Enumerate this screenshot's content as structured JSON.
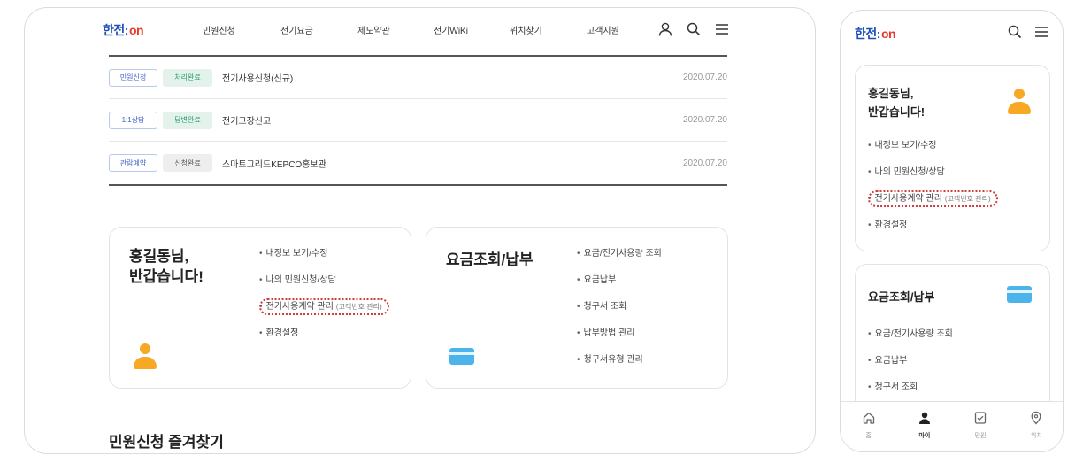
{
  "brand": {
    "logo_part1": "한전:",
    "logo_part2": "on",
    "primary": "#1d4fb8",
    "accent": "#e8392b"
  },
  "desktop": {
    "nav": [
      "민원신청",
      "전기요금",
      "제도약관",
      "전기WiKi",
      "위치찾기",
      "고객지원"
    ],
    "header_icons": [
      "user-icon",
      "search-icon",
      "menu-icon"
    ],
    "requests": [
      {
        "type": "민원신청",
        "status": "처리완료",
        "status_style": "green",
        "title": "전기사용신청(신규)",
        "date": "2020.07.20"
      },
      {
        "type": "1:1상담",
        "status": "답변완료",
        "status_style": "green",
        "title": "전기고장신고",
        "date": "2020.07.20"
      },
      {
        "type": "관람예약",
        "status": "신청완료",
        "status_style": "gray",
        "title": "스마트그리드KEPCO홍보관",
        "date": "2020.07.20"
      }
    ],
    "favorites_heading": "민원신청 즐겨찾기"
  },
  "account": {
    "greeting_line1": "홍길동님,",
    "greeting_line2": "반갑습니다!",
    "menu": [
      "내정보 보기/수정",
      "나의 민원신청/상담",
      "전기사용계약 관리",
      "환경설정"
    ],
    "menu_highlight_sub": "(고객번호 관리)"
  },
  "billing": {
    "title": "요금조회/납부",
    "menu": [
      "요금/전기사용량 조회",
      "요금납부",
      "청구서 조회",
      "납부방법 관리",
      "청구서유형 관리"
    ]
  },
  "mobile": {
    "tabs": [
      {
        "label": "홈",
        "icon": "home-icon"
      },
      {
        "label": "마이",
        "icon": "person-icon"
      },
      {
        "label": "민원",
        "icon": "document-check-icon"
      },
      {
        "label": "위치",
        "icon": "location-pin-icon"
      }
    ],
    "active_tab": "마이"
  },
  "colors": {
    "highlight_outline": "#d23b3b",
    "status_green": "#2a9a6a",
    "type_badge": "#3e64c8",
    "person_icon": "#f7a824",
    "card_icon": "#4cb4ea"
  }
}
